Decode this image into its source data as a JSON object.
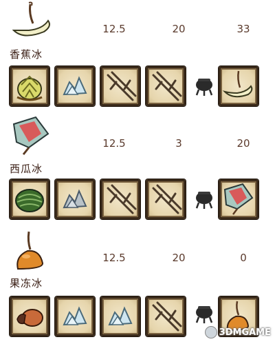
{
  "recipes": [
    {
      "name": "香蕉冰",
      "stats": [
        "12.5",
        "20",
        "33"
      ],
      "result_icon": "banana-pop-icon",
      "ingredients": [
        "banana-bunch-icon",
        "ice-icon",
        "twigs-icon",
        "twigs-icon"
      ]
    },
    {
      "name": "西瓜冰",
      "stats": [
        "12.5",
        "3",
        "20"
      ],
      "result_icon": "melonsicle-icon",
      "ingredients": [
        "watermelon-icon",
        "ice-icon",
        "twigs-icon",
        "twigs-icon"
      ]
    },
    {
      "name": "果冻冰",
      "stats": [
        "12.5",
        "20",
        "0"
      ],
      "result_icon": "jelly-pop-icon",
      "ingredients": [
        "dried-fruit-icon",
        "ice-icon",
        "ice-icon",
        "twigs-icon"
      ]
    }
  ],
  "watermark": {
    "text": "3DMGAME"
  },
  "colors": {
    "slot_bg": "#ecdcb6",
    "slot_border": "#3a2a1a",
    "stat_text": "#5a3a2c",
    "name_text": "#3a1e14"
  }
}
